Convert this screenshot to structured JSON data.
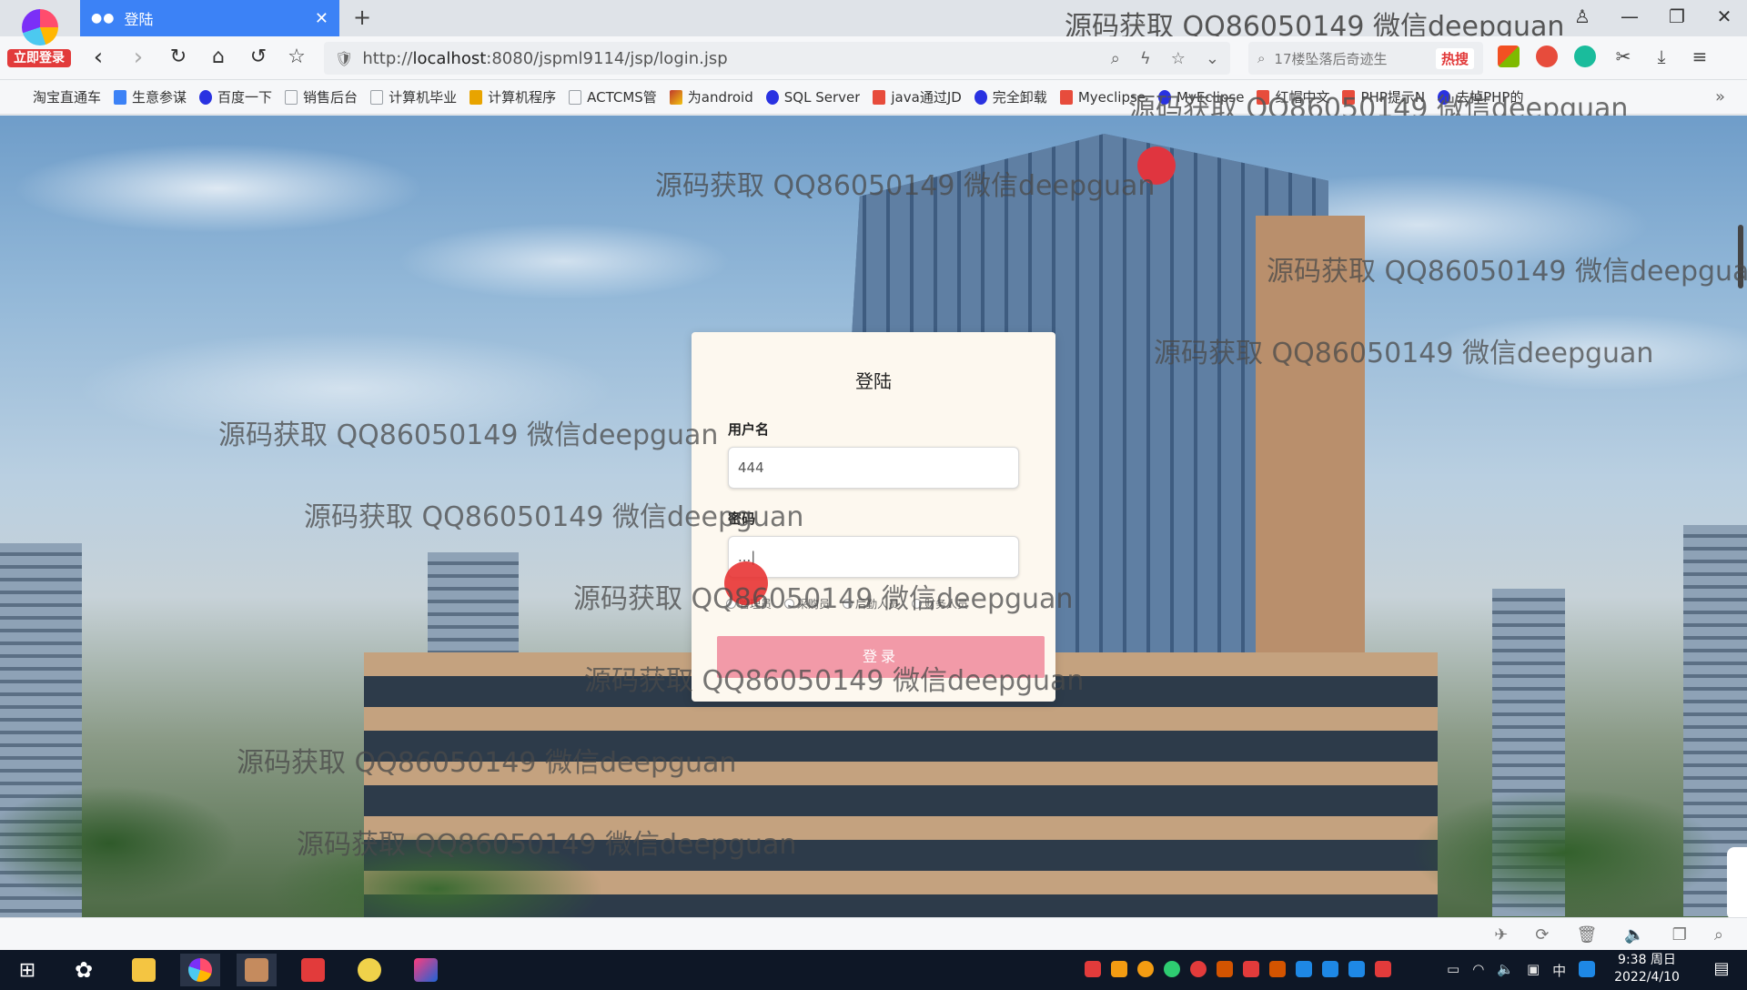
{
  "browser": {
    "brand_label": "立即登录",
    "tab": {
      "title": "登陆"
    },
    "title_watermark": "源码获取 QQ86050149 微信deepguan",
    "address": {
      "scheme": "http://",
      "host": "localhost",
      "path": ":8080/jspml9114/jsp/login.jsp"
    },
    "search": {
      "placeholder": "17楼坠落后奇迹生",
      "hot_badge": "热搜"
    },
    "bookmarks": [
      {
        "label": "淘宝直通车",
        "color": "#9aa0a6"
      },
      {
        "label": "生意参谋",
        "color": "#3c82f6"
      },
      {
        "label": "百度一下",
        "color": "#2932e1"
      },
      {
        "label": "销售后台",
        "color": "#9aa0a6"
      },
      {
        "label": "计算机毕业",
        "color": "#9aa0a6"
      },
      {
        "label": "计算机程序",
        "color": "#e8a400"
      },
      {
        "label": "ACTCMS管",
        "color": "#9aa0a6"
      },
      {
        "label": "为android",
        "color": "#c0392b"
      },
      {
        "label": "SQL Server",
        "color": "#2932e1"
      },
      {
        "label": "java通过JD",
        "color": "#e74c3c"
      },
      {
        "label": "完全卸载",
        "color": "#2932e1"
      },
      {
        "label": "Myeclipse",
        "color": "#e74c3c"
      },
      {
        "label": "MyEclipse",
        "color": "#2932e1"
      },
      {
        "label": "红帽中文",
        "color": "#e74c3c"
      },
      {
        "label": "PHP提示N",
        "color": "#e74c3c"
      },
      {
        "label": "去掉PHP的",
        "color": "#2932e1"
      }
    ],
    "bookmarks_watermark": "源码获取 QQ86050149 微信deepguan"
  },
  "login": {
    "title": "登陆",
    "username_label": "用户名",
    "username_value": "444",
    "password_label": "密码",
    "password_value": "...|",
    "roles": [
      "管理员",
      "采购员",
      "后勤人员",
      "财务人员"
    ],
    "submit_label": "登录"
  },
  "watermarks": [
    "源码获取 QQ86050149 微信deepguan",
    "源码获取 QQ86050149 微信deepguan",
    "源码获取 QQ86050149 微信deepguan",
    "源码获取 QQ86050149 微信deepguan",
    "源码获取 QQ86050149 微信deepguan",
    "源码获取 QQ86050149 微信deepguan",
    "源码获取 QQ86050149 微信deepguan",
    "源码获取 QQ86050149 微信deepguan",
    "源码获取 QQ86050149 微信deepguan"
  ],
  "taskbar": {
    "time": "9:38 周日",
    "date": "2022/4/10",
    "ime": "中"
  }
}
